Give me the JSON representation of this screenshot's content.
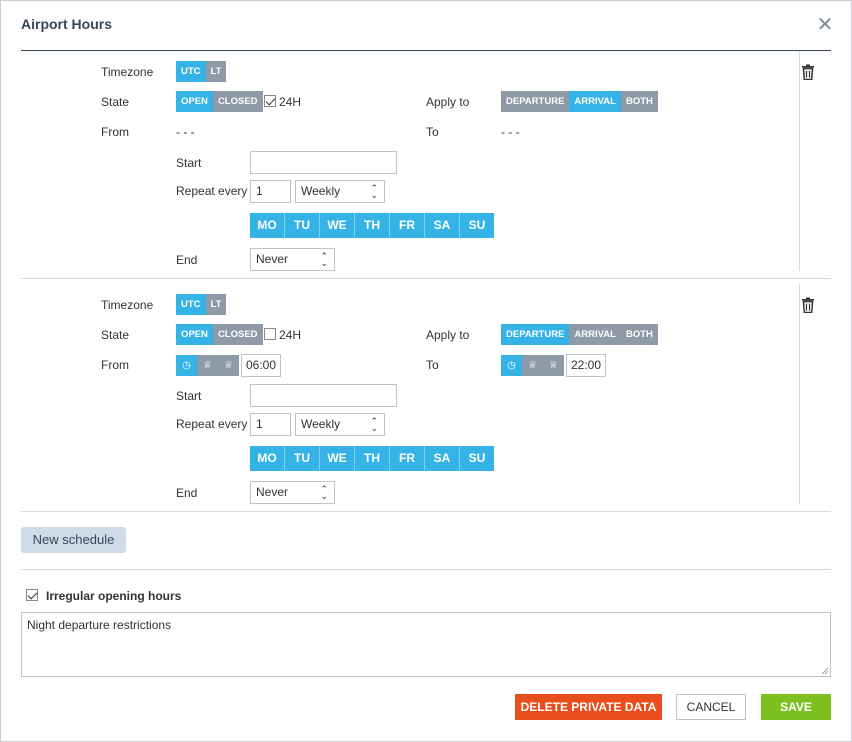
{
  "dialog": {
    "title": "Airport Hours"
  },
  "labels": {
    "timezone": "Timezone",
    "state": "State",
    "from": "From",
    "to": "To",
    "apply_to": "Apply to",
    "start": "Start",
    "repeat_every": "Repeat every",
    "end": "End",
    "h24": "24H"
  },
  "options": {
    "timezone": [
      "UTC",
      "LT"
    ],
    "state": [
      "OPEN",
      "CLOSED"
    ],
    "apply_to": [
      "DEPARTURE",
      "ARRIVAL",
      "BOTH"
    ],
    "days": [
      "MO",
      "TU",
      "WE",
      "TH",
      "FR",
      "SA",
      "SU"
    ]
  },
  "schedules": [
    {
      "timezone_selected": "UTC",
      "state_selected": "OPEN",
      "h24_checked": true,
      "apply_to_selected": "ARRIVAL",
      "from_value": "- - -",
      "to_value": "- - -",
      "start_value": "",
      "repeat_value": "1",
      "repeat_unit": "Weekly",
      "end_value": "Never"
    },
    {
      "timezone_selected": "UTC",
      "state_selected": "OPEN",
      "h24_checked": false,
      "apply_to_selected": "DEPARTURE",
      "from_time": "06:00",
      "to_time": "22:00",
      "start_value": "",
      "repeat_value": "1",
      "repeat_unit": "Weekly",
      "end_value": "Never"
    }
  ],
  "new_schedule_label": "New schedule",
  "irregular": {
    "label": "Irregular opening hours",
    "checked": true,
    "text": "Night departure restrictions"
  },
  "buttons": {
    "delete": "DELETE PRIVATE DATA",
    "cancel": "CANCEL",
    "save": "SAVE"
  },
  "colors": {
    "accent": "#36b3e6",
    "inactive": "#8e9aa8",
    "danger": "#e84e1b",
    "success": "#7cc11f",
    "title": "#35475a"
  },
  "icons": {
    "close": "close-icon",
    "trash": "trash-icon",
    "clock": "clock-icon",
    "sunrise": "sunrise-icon",
    "sunset": "sunset-icon"
  }
}
